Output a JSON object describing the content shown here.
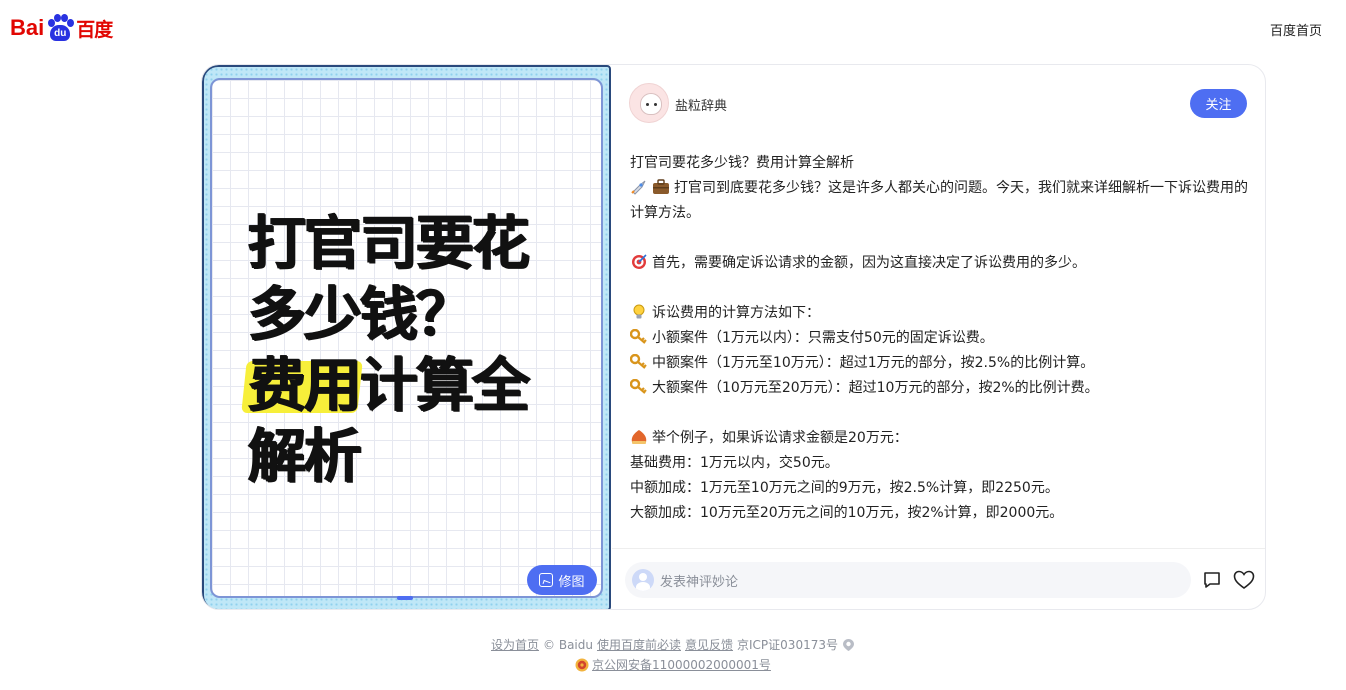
{
  "header": {
    "logo_left": "Bai",
    "logo_paw": "du",
    "logo_cn": "百度",
    "home_link": "百度首页"
  },
  "image_panel": {
    "title_lines": [
      "打官司要花",
      "多少钱？"
    ],
    "title_highlight": "费用",
    "title_line3_rest": "计算全",
    "title_line4": "解析",
    "edit_button": "修图"
  },
  "post": {
    "author": "盐粒辞典",
    "follow_button": "关注",
    "heading": "打官司要花多少钱？费用计算全解析",
    "intro": "打官司到底要花多少钱？这是许多人都关心的问题。今天，我们就来详细解析一下诉讼费用的计算方法。",
    "first": "首先，需要确定诉讼请求的金额，因为这直接决定了诉讼费用的多少。",
    "method_title": "诉讼费用的计算方法如下：",
    "methods": [
      "小额案件（1万元以内）：只需支付50元的固定诉讼费。",
      "中额案件（1万元至10万元）：超过1万元的部分，按2.5%的比例计算。",
      "大额案件（10万元至20万元）：超过10万元的部分，按2%的比例计费。"
    ],
    "example_title": "举个例子，如果诉讼请求金额是20万元：",
    "example_lines": [
      "基础费用：1万元以内，交50元。",
      "中额加成：1万元至10万元之间的9万元，按2.5%计算，即2250元。",
      "大额加成：10万元至20万元之间的10万元，按2%计算，即2000元。"
    ]
  },
  "comment": {
    "placeholder": "发表神评妙论"
  },
  "footer": {
    "set_home": "设为首页",
    "copyright": "© Baidu",
    "must_read": "使用百度前必读",
    "feedback": "意见反馈",
    "icp": "京ICP证030173号",
    "police": "京公网安备11000002000001号"
  },
  "colors": {
    "brand_red": "#e10602",
    "brand_blue": "#2932e1",
    "accent": "#4e6ef2"
  }
}
